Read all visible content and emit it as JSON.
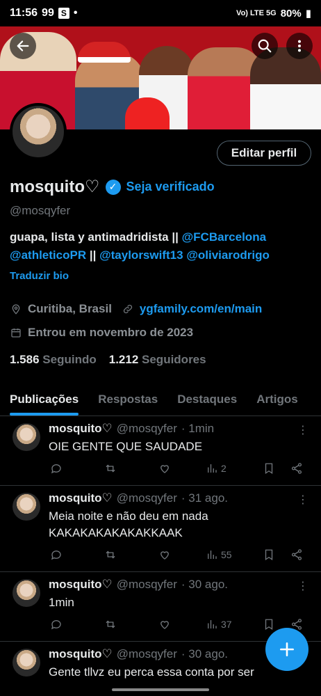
{
  "status_bar": {
    "time": "11:56",
    "left_icons": "99",
    "badge": "S",
    "battery": "80%",
    "signal_text": "Vo) LTE 5G"
  },
  "header": {
    "back_icon": "arrow-left-icon",
    "search_icon": "search-icon",
    "more_icon": "more-vertical-icon"
  },
  "profile": {
    "name": "mosquito♡",
    "verify_link": "Seja verificado",
    "handle": "@mosqyfer",
    "edit_button": "Editar perfil",
    "bio_text_1": "guapa, lista y antimadridista || ",
    "bio_link_1": "@FCBarcelona",
    "bio_link_2": "@athleticoPR",
    "bio_sep": " || ",
    "bio_link_3": "@taylorswift13",
    "bio_link_4": "@oliviarodrigo",
    "translate": "Traduzir bio",
    "location": "Curitiba, Brasil",
    "website": "ygfamily.com/en/main",
    "joined": "Entrou em novembro de 2023",
    "following_count": "1.586",
    "following_label": "Seguindo",
    "followers_count": "1.212",
    "followers_label": "Seguidores"
  },
  "tabs": [
    "Publicações",
    "Respostas",
    "Destaques",
    "Artigos"
  ],
  "tweets": [
    {
      "name": "mosquito♡",
      "handle": "@mosqyfer",
      "time": "· 1min",
      "text": "OIE GENTE QUE SAUDADE",
      "views": "2"
    },
    {
      "name": "mosquito♡",
      "handle": "@mosqyfer",
      "time": "· 31 ago.",
      "text": "Meia noite e não deu em nada KAKAKAKAKAKAKKAAK",
      "views": "55"
    },
    {
      "name": "mosquito♡",
      "handle": "@mosqyfer",
      "time": "· 30 ago.",
      "text": "1min",
      "views": "37"
    },
    {
      "name": "mosquito♡",
      "handle": "@mosqyfer",
      "time": "· 30 ago.",
      "text": "Gente tllvz eu perca essa conta por ser",
      "views": ""
    }
  ],
  "colors": {
    "accent": "#1d9bf0",
    "background": "#000000",
    "banner": "#b0101a"
  }
}
